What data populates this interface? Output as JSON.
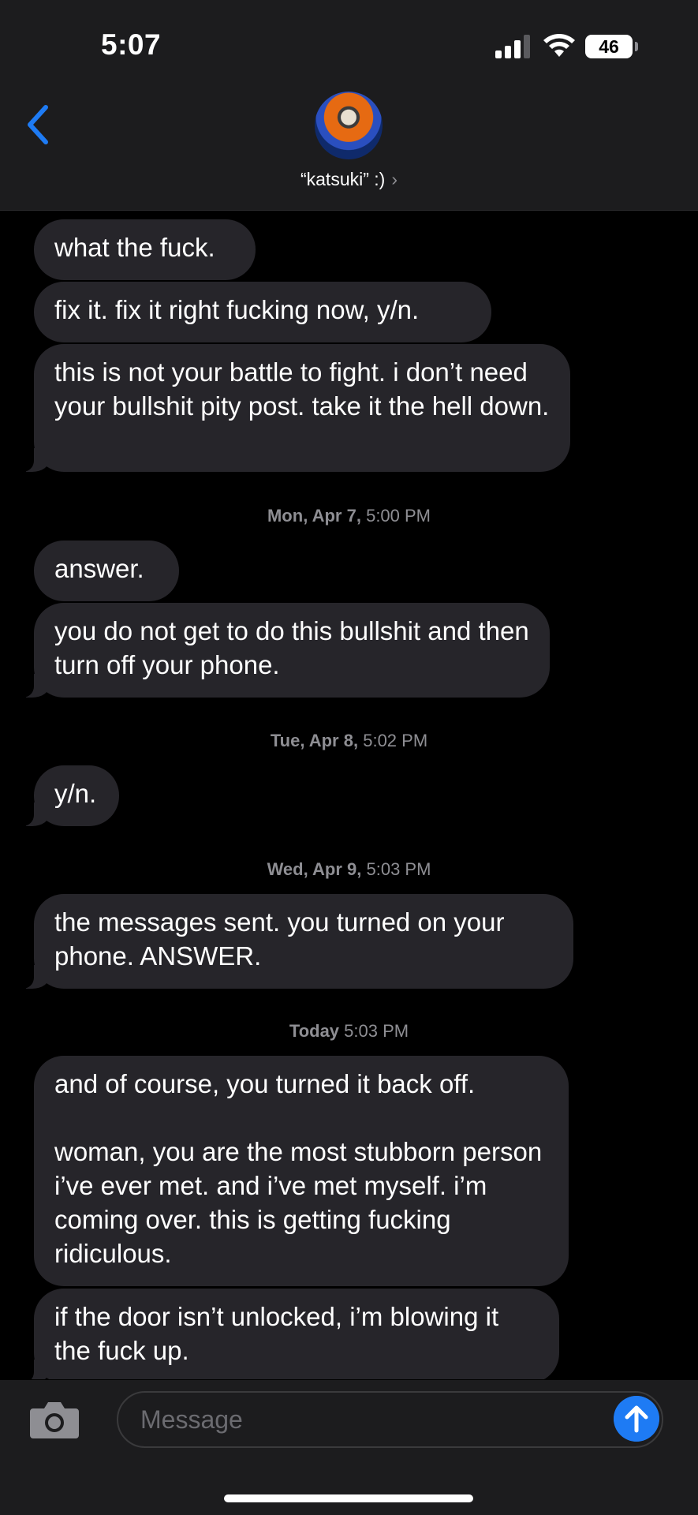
{
  "status_bar": {
    "time": "5:07",
    "battery": "46"
  },
  "header": {
    "contact_name": "“katsuki” :)",
    "chevron": "›"
  },
  "messages": [
    {
      "text": "what the fuck."
    },
    {
      "text": "fix it. fix it right fucking now, y/n."
    },
    {
      "text": "this is not your battle to fight. i don’t need your bullshit pity post. take it the hell down."
    },
    {
      "date": "Mon, Apr 7,",
      "time": "5:00 PM"
    },
    {
      "text": "answer."
    },
    {
      "text": "you do not get to do this bullshit and then turn off your phone."
    },
    {
      "date": "Tue, Apr 8,",
      "time": "5:02 PM"
    },
    {
      "text": "y/n."
    },
    {
      "date": "Wed, Apr 9,",
      "time": "5:03 PM"
    },
    {
      "text": "the messages sent. you turned on your phone. ANSWER."
    },
    {
      "date": "Today",
      "time": "5:03 PM"
    },
    {
      "text": "and of course, you turned it back off.",
      "text2": "woman, you are the most stubborn person i’ve ever met. and i’ve met myself. i’m coming over. this is getting fucking ridiculous."
    },
    {
      "text": "if the door isn’t unlocked, i’m blowing it the fuck up."
    }
  ],
  "composer": {
    "placeholder": "Message"
  },
  "icons": {
    "back": "chevron-left-icon",
    "camera": "camera-icon",
    "send": "arrow-up-icon",
    "signal": "cellular-signal-icon",
    "wifi": "wifi-icon",
    "battery": "battery-icon"
  },
  "colors": {
    "accent": "#1e7bf4",
    "bubble": "#26252a",
    "background": "#000000"
  }
}
